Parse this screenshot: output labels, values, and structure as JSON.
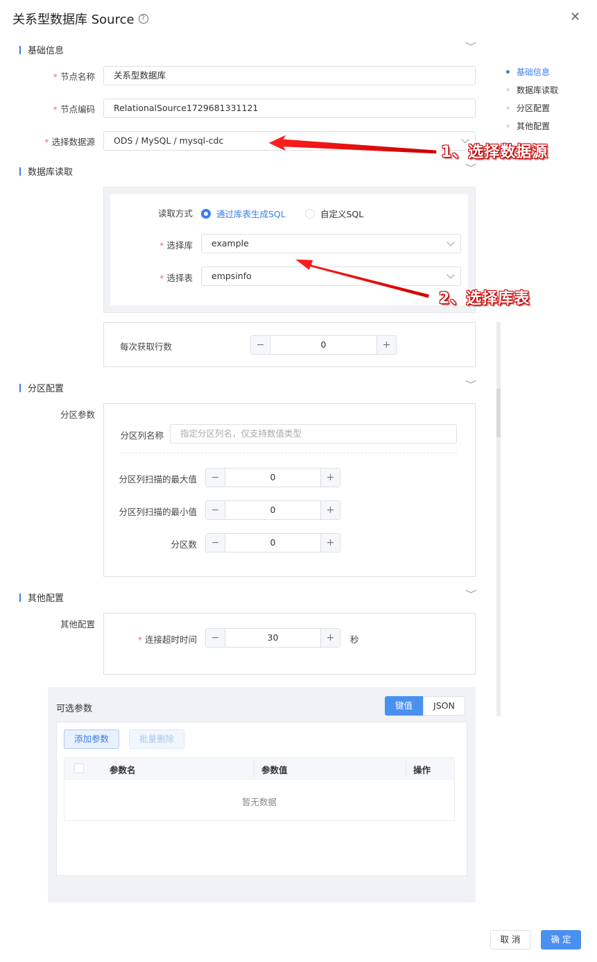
{
  "dialog": {
    "title": "关系型数据库 Source",
    "help_glyph": "?",
    "close_glyph": "✕"
  },
  "nav": {
    "items": [
      {
        "label": "基础信息",
        "active": true
      },
      {
        "label": "数据库读取",
        "active": false
      },
      {
        "label": "分区配置",
        "active": false
      },
      {
        "label": "其他配置",
        "active": false
      }
    ]
  },
  "basic": {
    "section_title": "基础信息",
    "node_name_label": "节点名称",
    "node_name_value": "关系型数据库",
    "node_code_label": "节点编码",
    "node_code_value": "RelationalSource1729681331121",
    "datasource_label": "选择数据源",
    "datasource_value": "ODS / MySQL / mysql-cdc"
  },
  "db_read": {
    "section_title": "数据库读取",
    "read_mode_label": "读取方式",
    "mode_table": "通过库表生成SQL",
    "mode_custom": "自定义SQL",
    "db_label": "选择库",
    "db_value": "example",
    "table_label": "选择表",
    "table_value": "empsinfo",
    "fetch_rows_label": "每次获取行数",
    "fetch_rows_value": "0"
  },
  "partition": {
    "section_title": "分区配置",
    "params_label": "分区参数",
    "column_label": "分区列名称",
    "column_placeholder": "指定分区列名，仅支持数值类型",
    "max_label": "分区列扫描的最大值",
    "max_value": "0",
    "min_label": "分区列扫描的最小值",
    "min_value": "0",
    "count_label": "分区数",
    "count_value": "0"
  },
  "other": {
    "section_title": "其他配置",
    "config_label": "其他配置",
    "timeout_label": "连接超时时间",
    "timeout_value": "30",
    "timeout_unit": "秒"
  },
  "optional": {
    "title": "可选参数",
    "tab_kv": "键值",
    "tab_json": "JSON",
    "add_button": "添加参数",
    "batch_delete_button": "批量删除",
    "columns": [
      "参数名",
      "参数值",
      "操作"
    ],
    "empty_text": "暂无数据"
  },
  "footer": {
    "cancel": "取 消",
    "confirm": "确 定"
  },
  "annotations": {
    "step1": "1、选择数据源",
    "step2": "2、选择库表"
  },
  "stepper": {
    "minus": "−",
    "plus": "+"
  },
  "required_mark": "*"
}
